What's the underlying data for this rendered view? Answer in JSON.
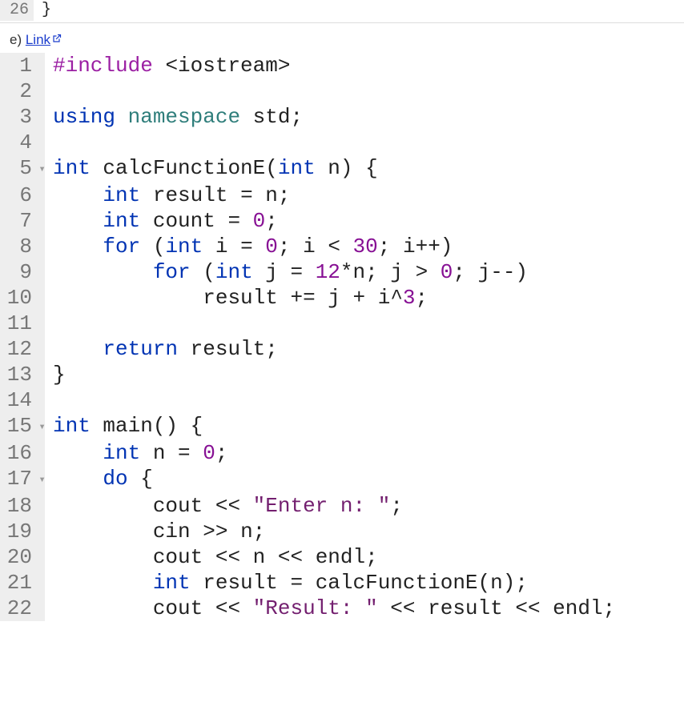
{
  "top_code": {
    "lines": [
      {
        "n": "26",
        "tokens": [
          [
            "id",
            "}"
          ]
        ]
      }
    ]
  },
  "sub": {
    "prefix": "e) ",
    "link_text": "Link"
  },
  "code": {
    "lines": [
      {
        "n": "1",
        "fold": "",
        "indent": "",
        "tokens": [
          [
            "pp",
            "#include"
          ],
          [
            "sym",
            " "
          ],
          [
            "inc",
            "<iostream>"
          ]
        ]
      },
      {
        "n": "2",
        "fold": "",
        "indent": "",
        "tokens": []
      },
      {
        "n": "3",
        "fold": "",
        "indent": "",
        "tokens": [
          [
            "kw",
            "using"
          ],
          [
            "sym",
            " "
          ],
          [
            "ns",
            "namespace"
          ],
          [
            "sym",
            " "
          ],
          [
            "id",
            "std"
          ],
          [
            "sym",
            ";"
          ]
        ]
      },
      {
        "n": "4",
        "fold": "",
        "indent": "",
        "tokens": []
      },
      {
        "n": "5",
        "fold": "▾",
        "indent": "",
        "tokens": [
          [
            "kw",
            "int"
          ],
          [
            "sym",
            " "
          ],
          [
            "id",
            "calcFunctionE"
          ],
          [
            "sym",
            "("
          ],
          [
            "kw",
            "int"
          ],
          [
            "sym",
            " "
          ],
          [
            "id",
            "n"
          ],
          [
            "sym",
            ") {"
          ]
        ]
      },
      {
        "n": "6",
        "fold": "",
        "indent": "    ",
        "tokens": [
          [
            "kw",
            "int"
          ],
          [
            "sym",
            " "
          ],
          [
            "id",
            "result"
          ],
          [
            "sym",
            " = "
          ],
          [
            "id",
            "n"
          ],
          [
            "sym",
            ";"
          ]
        ]
      },
      {
        "n": "7",
        "fold": "",
        "indent": "    ",
        "tokens": [
          [
            "kw",
            "int"
          ],
          [
            "sym",
            " "
          ],
          [
            "id",
            "count"
          ],
          [
            "sym",
            " = "
          ],
          [
            "num",
            "0"
          ],
          [
            "sym",
            ";"
          ]
        ]
      },
      {
        "n": "8",
        "fold": "",
        "indent": "    ",
        "tokens": [
          [
            "kw",
            "for"
          ],
          [
            "sym",
            " ("
          ],
          [
            "kw",
            "int"
          ],
          [
            "sym",
            " "
          ],
          [
            "id",
            "i"
          ],
          [
            "sym",
            " = "
          ],
          [
            "num",
            "0"
          ],
          [
            "sym",
            "; "
          ],
          [
            "id",
            "i"
          ],
          [
            "sym",
            " < "
          ],
          [
            "num",
            "30"
          ],
          [
            "sym",
            "; "
          ],
          [
            "id",
            "i"
          ],
          [
            "sym",
            "++)"
          ]
        ]
      },
      {
        "n": "9",
        "fold": "",
        "indent": "        ",
        "tokens": [
          [
            "kw",
            "for"
          ],
          [
            "sym",
            " ("
          ],
          [
            "kw",
            "int"
          ],
          [
            "sym",
            " "
          ],
          [
            "id",
            "j"
          ],
          [
            "sym",
            " = "
          ],
          [
            "num",
            "12"
          ],
          [
            "sym",
            "*"
          ],
          [
            "id",
            "n"
          ],
          [
            "sym",
            "; "
          ],
          [
            "id",
            "j"
          ],
          [
            "sym",
            " > "
          ],
          [
            "num",
            "0"
          ],
          [
            "sym",
            "; "
          ],
          [
            "id",
            "j"
          ],
          [
            "sym",
            "--)"
          ]
        ]
      },
      {
        "n": "10",
        "fold": "",
        "indent": "            ",
        "tokens": [
          [
            "id",
            "result"
          ],
          [
            "sym",
            " += "
          ],
          [
            "id",
            "j"
          ],
          [
            "sym",
            " + "
          ],
          [
            "id",
            "i"
          ],
          [
            "sym",
            "^"
          ],
          [
            "num",
            "3"
          ],
          [
            "sym",
            ";"
          ]
        ]
      },
      {
        "n": "11",
        "fold": "",
        "indent": "",
        "tokens": []
      },
      {
        "n": "12",
        "fold": "",
        "indent": "    ",
        "tokens": [
          [
            "kw",
            "return"
          ],
          [
            "sym",
            " "
          ],
          [
            "id",
            "result"
          ],
          [
            "sym",
            ";"
          ]
        ]
      },
      {
        "n": "13",
        "fold": "",
        "indent": "",
        "tokens": [
          [
            "sym",
            "}"
          ]
        ]
      },
      {
        "n": "14",
        "fold": "",
        "indent": "",
        "tokens": []
      },
      {
        "n": "15",
        "fold": "▾",
        "indent": "",
        "tokens": [
          [
            "kw",
            "int"
          ],
          [
            "sym",
            " "
          ],
          [
            "id",
            "main"
          ],
          [
            "sym",
            "() {"
          ]
        ]
      },
      {
        "n": "16",
        "fold": "",
        "indent": "    ",
        "tokens": [
          [
            "kw",
            "int"
          ],
          [
            "sym",
            " "
          ],
          [
            "id",
            "n"
          ],
          [
            "sym",
            " = "
          ],
          [
            "num",
            "0"
          ],
          [
            "sym",
            ";"
          ]
        ]
      },
      {
        "n": "17",
        "fold": "▾",
        "indent": "    ",
        "tokens": [
          [
            "kw",
            "do"
          ],
          [
            "sym",
            " {"
          ]
        ]
      },
      {
        "n": "18",
        "fold": "",
        "indent": "        ",
        "tokens": [
          [
            "id",
            "cout"
          ],
          [
            "sym",
            " << "
          ],
          [
            "str",
            "\"Enter n: \""
          ],
          [
            "sym",
            ";"
          ]
        ]
      },
      {
        "n": "19",
        "fold": "",
        "indent": "        ",
        "tokens": [
          [
            "id",
            "cin"
          ],
          [
            "sym",
            " >> "
          ],
          [
            "id",
            "n"
          ],
          [
            "sym",
            ";"
          ]
        ]
      },
      {
        "n": "20",
        "fold": "",
        "indent": "        ",
        "tokens": [
          [
            "id",
            "cout"
          ],
          [
            "sym",
            " << "
          ],
          [
            "id",
            "n"
          ],
          [
            "sym",
            " << "
          ],
          [
            "id",
            "endl"
          ],
          [
            "sym",
            ";"
          ]
        ]
      },
      {
        "n": "21",
        "fold": "",
        "indent": "        ",
        "tokens": [
          [
            "kw",
            "int"
          ],
          [
            "sym",
            " "
          ],
          [
            "id",
            "result"
          ],
          [
            "sym",
            " = "
          ],
          [
            "id",
            "calcFunctionE"
          ],
          [
            "sym",
            "("
          ],
          [
            "id",
            "n"
          ],
          [
            "sym",
            ");"
          ]
        ]
      },
      {
        "n": "22",
        "fold": "",
        "indent": "        ",
        "tokens": [
          [
            "id",
            "cout"
          ],
          [
            "sym",
            " << "
          ],
          [
            "str",
            "\"Result: \""
          ],
          [
            "sym",
            " << "
          ],
          [
            "id",
            "result"
          ],
          [
            "sym",
            " << "
          ],
          [
            "id",
            "endl"
          ],
          [
            "sym",
            ";"
          ]
        ]
      }
    ]
  }
}
